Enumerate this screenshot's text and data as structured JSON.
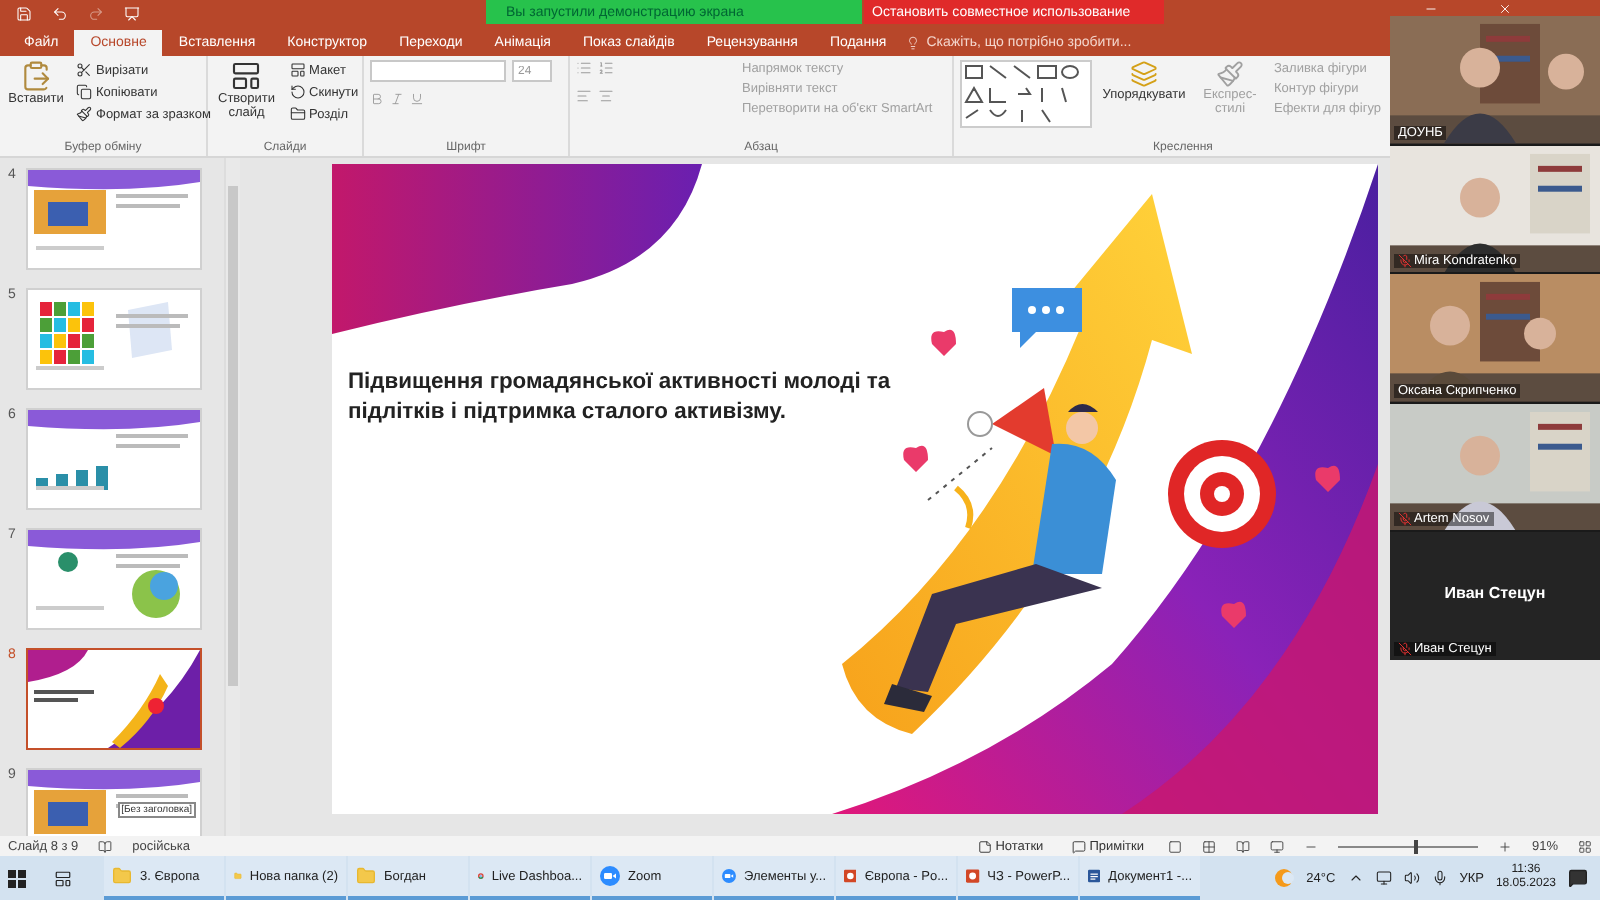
{
  "share_banner": {
    "message": "Вы запустили демонстрацию экрана",
    "stop_button": "Остановить совместное использование"
  },
  "tabs": [
    {
      "label": "Файл",
      "selected": false
    },
    {
      "label": "Основне",
      "selected": true
    },
    {
      "label": "Вставлення",
      "selected": false
    },
    {
      "label": "Конструктор",
      "selected": false
    },
    {
      "label": "Переходи",
      "selected": false
    },
    {
      "label": "Анімація",
      "selected": false
    },
    {
      "label": "Показ слайдів",
      "selected": false
    },
    {
      "label": "Рецензування",
      "selected": false
    },
    {
      "label": "Подання",
      "selected": false
    }
  ],
  "tell_me": {
    "placeholder": "Скажіть, що потрібно зробити..."
  },
  "ribbon": {
    "clipboard": {
      "label": "Буфер обміну",
      "big_button": "Вставити",
      "small_buttons": [
        {
          "label": "Вирізати",
          "disabled": false
        },
        {
          "label": "Копіювати",
          "disabled": false
        },
        {
          "label": "Формат за зразком",
          "disabled": false
        }
      ]
    },
    "slides": {
      "label": "Слайди",
      "big_button": "Створити слайд",
      "small_buttons": [
        {
          "label": "Макет",
          "disabled": false
        },
        {
          "label": "Скинути",
          "disabled": false
        },
        {
          "label": "Розділ",
          "disabled": false
        }
      ]
    },
    "font": {
      "label": "Шрифт",
      "font_size": "24"
    },
    "paragraph": {
      "label": "Абзац",
      "small_buttons": [
        {
          "label": "Напрямок тексту",
          "disabled": true
        },
        {
          "label": "Вирівняти текст",
          "disabled": true
        },
        {
          "label": "Перетворити на об'єкт SmartArt",
          "disabled": true
        }
      ]
    },
    "drawing": {
      "label": "Креслення",
      "big_buttons": [
        {
          "label": "Упорядкувати",
          "disabled": false
        },
        {
          "label": "Експрес-стилі",
          "disabled": true
        }
      ],
      "small_buttons": [
        {
          "label": "Заливка фігури",
          "disabled": true
        },
        {
          "label": "Контур фігури",
          "disabled": true
        },
        {
          "label": "Ефекти для фігур",
          "disabled": true
        }
      ]
    }
  },
  "thumbnails": [
    {
      "number": "4",
      "selected": false
    },
    {
      "number": "5",
      "selected": false,
      "kind": "grid"
    },
    {
      "number": "6",
      "selected": false,
      "kind": "icons"
    },
    {
      "number": "7",
      "selected": false,
      "kind": "cycle"
    },
    {
      "number": "8",
      "selected": true,
      "kind": "cover"
    },
    {
      "number": "9",
      "selected": false,
      "caption": "[Без заголовка]"
    }
  ],
  "slide": {
    "title": "Підвищення громадянської активності молоді та підлітків і підтримка сталого активізму."
  },
  "participants": [
    {
      "name": "ДОУНБ",
      "kind": "video",
      "muted": false
    },
    {
      "name": "Mira Kondratenko",
      "kind": "video",
      "muted": true
    },
    {
      "name": "Оксана Скрипченко",
      "kind": "video",
      "muted": false
    },
    {
      "name": "Artem Nosov",
      "kind": "video",
      "muted": true
    },
    {
      "name": "Иван Стецун",
      "kind": "avatar",
      "display_name": "Иван Стецун",
      "muted": true
    }
  ],
  "status_bar": {
    "slide_indicator": "Слайд 8 з 9",
    "language": "російська",
    "notes": "Нотатки",
    "comments": "Примітки",
    "zoom": {
      "level": 0.55,
      "reading": "91%"
    }
  },
  "taskbar": {
    "apps": [
      {
        "label": "3. Європа",
        "kind": "folder"
      },
      {
        "label": "Нова папка (2)",
        "kind": "folder"
      },
      {
        "label": "Богдан",
        "kind": "folder"
      },
      {
        "label": "Live Dashboa...",
        "kind": "chrome"
      },
      {
        "label": "Zoom",
        "kind": "zoom"
      },
      {
        "label": "Элементы у...",
        "kind": "zoom"
      },
      {
        "label": "Європа - Po...",
        "kind": "powerpoint"
      },
      {
        "label": "ЧЗ - PowerP...",
        "kind": "powerpoint"
      },
      {
        "label": "Документ1 -...",
        "kind": "word"
      }
    ],
    "weather": "24°C",
    "language": "УКР",
    "time": "11:36",
    "date": "18.05.2023"
  }
}
